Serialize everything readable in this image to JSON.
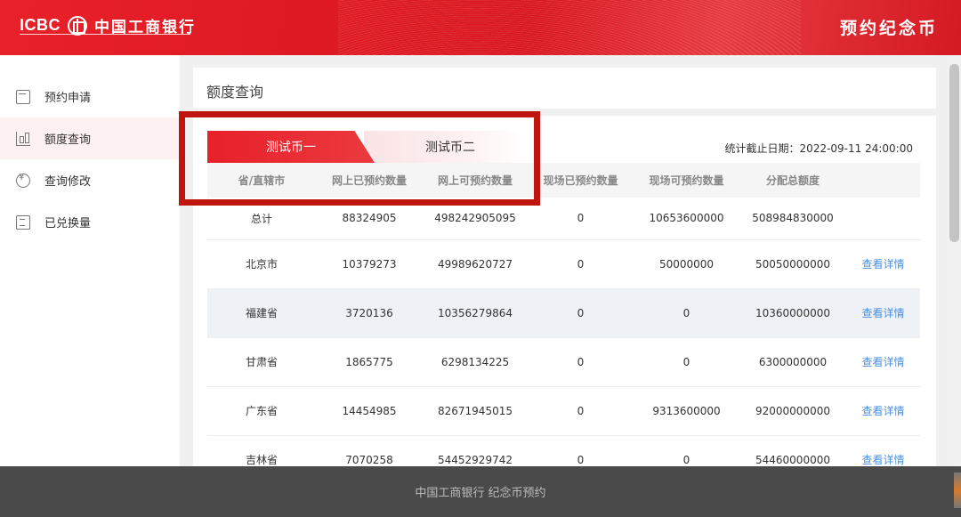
{
  "header": {
    "brand_en": "ICBC",
    "brand_cn": "中国工商银行",
    "page_brand": "预约纪念币"
  },
  "sidebar": {
    "items": [
      {
        "label": "预约申请",
        "icon": "calendar-icon",
        "active": false
      },
      {
        "label": "额度查询",
        "icon": "bar-chart-icon",
        "active": true
      },
      {
        "label": "查询修改",
        "icon": "coin-search-icon",
        "active": false
      },
      {
        "label": "已兑换量",
        "icon": "exchange-icon",
        "active": false
      }
    ]
  },
  "main": {
    "title": "额度查询",
    "tabs": [
      {
        "label": "测试币一",
        "active": true
      },
      {
        "label": "测试币二",
        "active": false
      }
    ],
    "stat_date": "统计截止日期：2022-09-11 24:00:00",
    "table": {
      "headers": [
        "省/直辖市",
        "网上已预约数量",
        "网上可预约数量",
        "现场已预约数量",
        "现场可预约数量",
        "分配总额度",
        ""
      ],
      "rows": [
        [
          "总计",
          "88324905",
          "498242905095",
          "0",
          "10653600000",
          "508984830000",
          ""
        ],
        [
          "北京市",
          "10379273",
          "49989620727",
          "0",
          "50000000",
          "50050000000",
          "查看详情"
        ],
        [
          "福建省",
          "3720136",
          "10356279864",
          "0",
          "0",
          "10360000000",
          "查看详情"
        ],
        [
          "甘肃省",
          "1865775",
          "6298134225",
          "0",
          "0",
          "6300000000",
          "查看详情"
        ],
        [
          "广东省",
          "14454985",
          "82671945015",
          "0",
          "9313600000",
          "92000000000",
          "查看详情"
        ],
        [
          "吉林省",
          "7070258",
          "54452929742",
          "0",
          "0",
          "54460000000",
          "查看详情"
        ]
      ]
    }
  },
  "footer": {
    "text": "中国工商银行 纪念币预约"
  },
  "colors": {
    "brand_red": "#e8202a",
    "highlight_box": "#c0140f",
    "link_blue": "#4a90e2",
    "footer_bg": "#4a4a4a"
  }
}
